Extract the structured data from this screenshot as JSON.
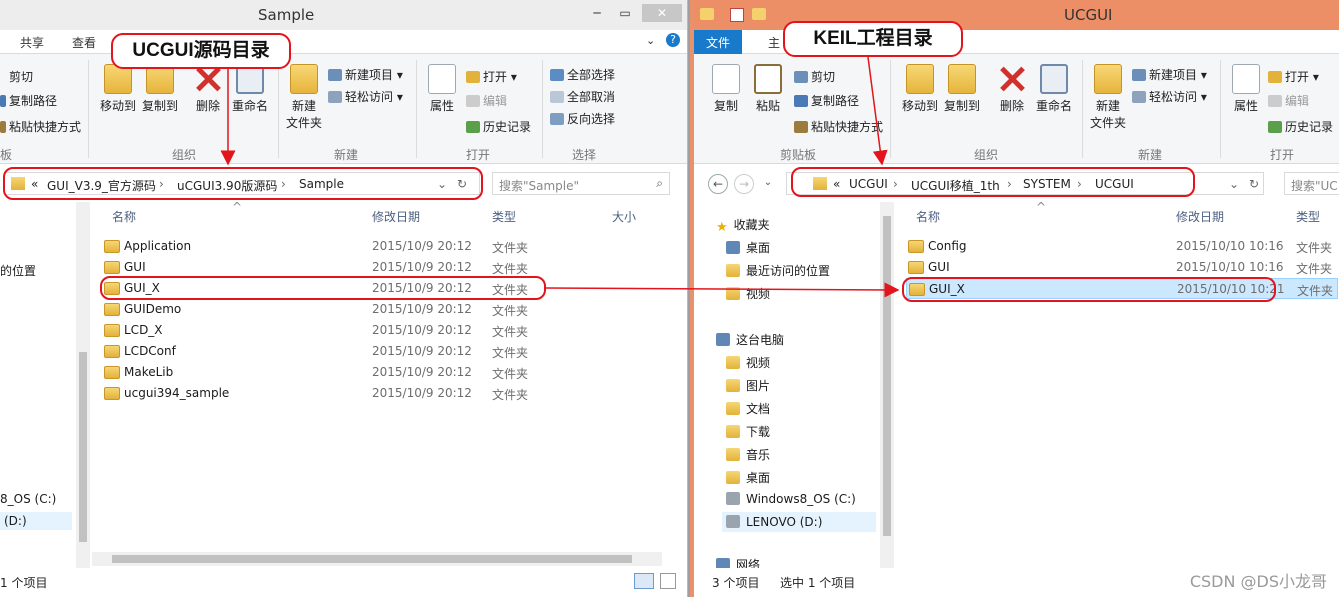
{
  "left": {
    "title": "Sample",
    "tabs": [
      "共享",
      "查看"
    ],
    "ribbon": {
      "cut": "剪切",
      "copy_path": "复制路径",
      "paste_shortcut": "粘贴快捷方式",
      "move_to": "移动到",
      "copy_to": "复制到",
      "delete": "删除",
      "rename": "重命名",
      "new_folder": "新建\n文件夹",
      "new_item": "新建项目 ▾",
      "easy_access": "轻松访问 ▾",
      "properties": "属性",
      "open": "打开 ▾",
      "edit": "编辑",
      "history": "历史记录",
      "select_all": "全部选择",
      "select_none": "全部取消",
      "invert_select": "反向选择",
      "group_clipboard_partial": "板",
      "group_organize": "组织",
      "group_new": "新建",
      "group_open": "打开",
      "group_select": "选择"
    },
    "breadcrumb": [
      "«",
      "GUI_V3.9_官方源码",
      "uCGUI3.90版源码",
      "Sample"
    ],
    "search_placeholder": "搜索\"Sample\"",
    "columns": {
      "name": "名称",
      "date": "修改日期",
      "type": "类型",
      "size": "大小"
    },
    "files": [
      {
        "name": "Application",
        "date": "2015/10/9 20:12",
        "type": "文件夹"
      },
      {
        "name": "GUI",
        "date": "2015/10/9 20:12",
        "type": "文件夹"
      },
      {
        "name": "GUI_X",
        "date": "2015/10/9 20:12",
        "type": "文件夹"
      },
      {
        "name": "GUIDemo",
        "date": "2015/10/9 20:12",
        "type": "文件夹"
      },
      {
        "name": "LCD_X",
        "date": "2015/10/9 20:12",
        "type": "文件夹"
      },
      {
        "name": "LCDConf",
        "date": "2015/10/9 20:12",
        "type": "文件夹"
      },
      {
        "name": "MakeLib",
        "date": "2015/10/9 20:12",
        "type": "文件夹"
      },
      {
        "name": "ucgui394_sample",
        "date": "2015/10/9 20:12",
        "type": "文件夹"
      }
    ],
    "nav_partial": {
      "recent": "的位置",
      "drive_c": "8_OS (C:)",
      "drive_d": "(D:)"
    },
    "status": "1 个项目"
  },
  "right": {
    "title": "UCGUI",
    "tabs": {
      "file": "文件",
      "home_partial": "主"
    },
    "ribbon": {
      "copy": "复制",
      "paste": "粘贴",
      "cut": "剪切",
      "copy_path": "复制路径",
      "paste_shortcut": "粘贴快捷方式",
      "move_to": "移动到",
      "copy_to": "复制到",
      "delete": "删除",
      "rename": "重命名",
      "new_folder": "新建\n文件夹",
      "new_item": "新建项目 ▾",
      "easy_access": "轻松访问 ▾",
      "properties": "属性",
      "open": "打开 ▾",
      "edit": "编辑",
      "history": "历史记录",
      "group_clipboard": "剪贴板",
      "group_organize": "组织",
      "group_new": "新建",
      "group_open": "打开"
    },
    "breadcrumb": [
      "«",
      "UCGUI",
      "UCGUI移植_1th",
      "SYSTEM",
      "UCGUI"
    ],
    "search_placeholder": "搜索\"UC",
    "columns": {
      "name": "名称",
      "date": "修改日期",
      "type": "类型"
    },
    "files": [
      {
        "name": "Config",
        "date": "2015/10/10 10:16",
        "type": "文件夹"
      },
      {
        "name": "GUI",
        "date": "2015/10/10 10:16",
        "type": "文件夹"
      },
      {
        "name": "GUI_X",
        "date": "2015/10/10 10:21",
        "type": "文件夹"
      }
    ],
    "nav": {
      "favorites": "收藏夹",
      "desktop": "桌面",
      "recent": "最近访问的位置",
      "videos_fav": "视频",
      "this_pc": "这台电脑",
      "videos": "视频",
      "pictures": "图片",
      "documents": "文档",
      "downloads": "下载",
      "music": "音乐",
      "desktop2": "桌面",
      "drive_c": "Windows8_OS (C:)",
      "drive_d": "LENOVO (D:)",
      "network_partial": "网络"
    },
    "status": {
      "count": "3 个项目",
      "selected": "选中 1 个项目"
    }
  },
  "annotations": {
    "left_label": "UCGUI源码目录",
    "right_label": "KEIL工程目录"
  },
  "watermark": "CSDN @DS小龙哥",
  "colors": {
    "accent_red": "#e3141b",
    "right_title_bar": "#ec8e66",
    "file_tab": "#1979ca",
    "selection": "#cce8ff"
  }
}
